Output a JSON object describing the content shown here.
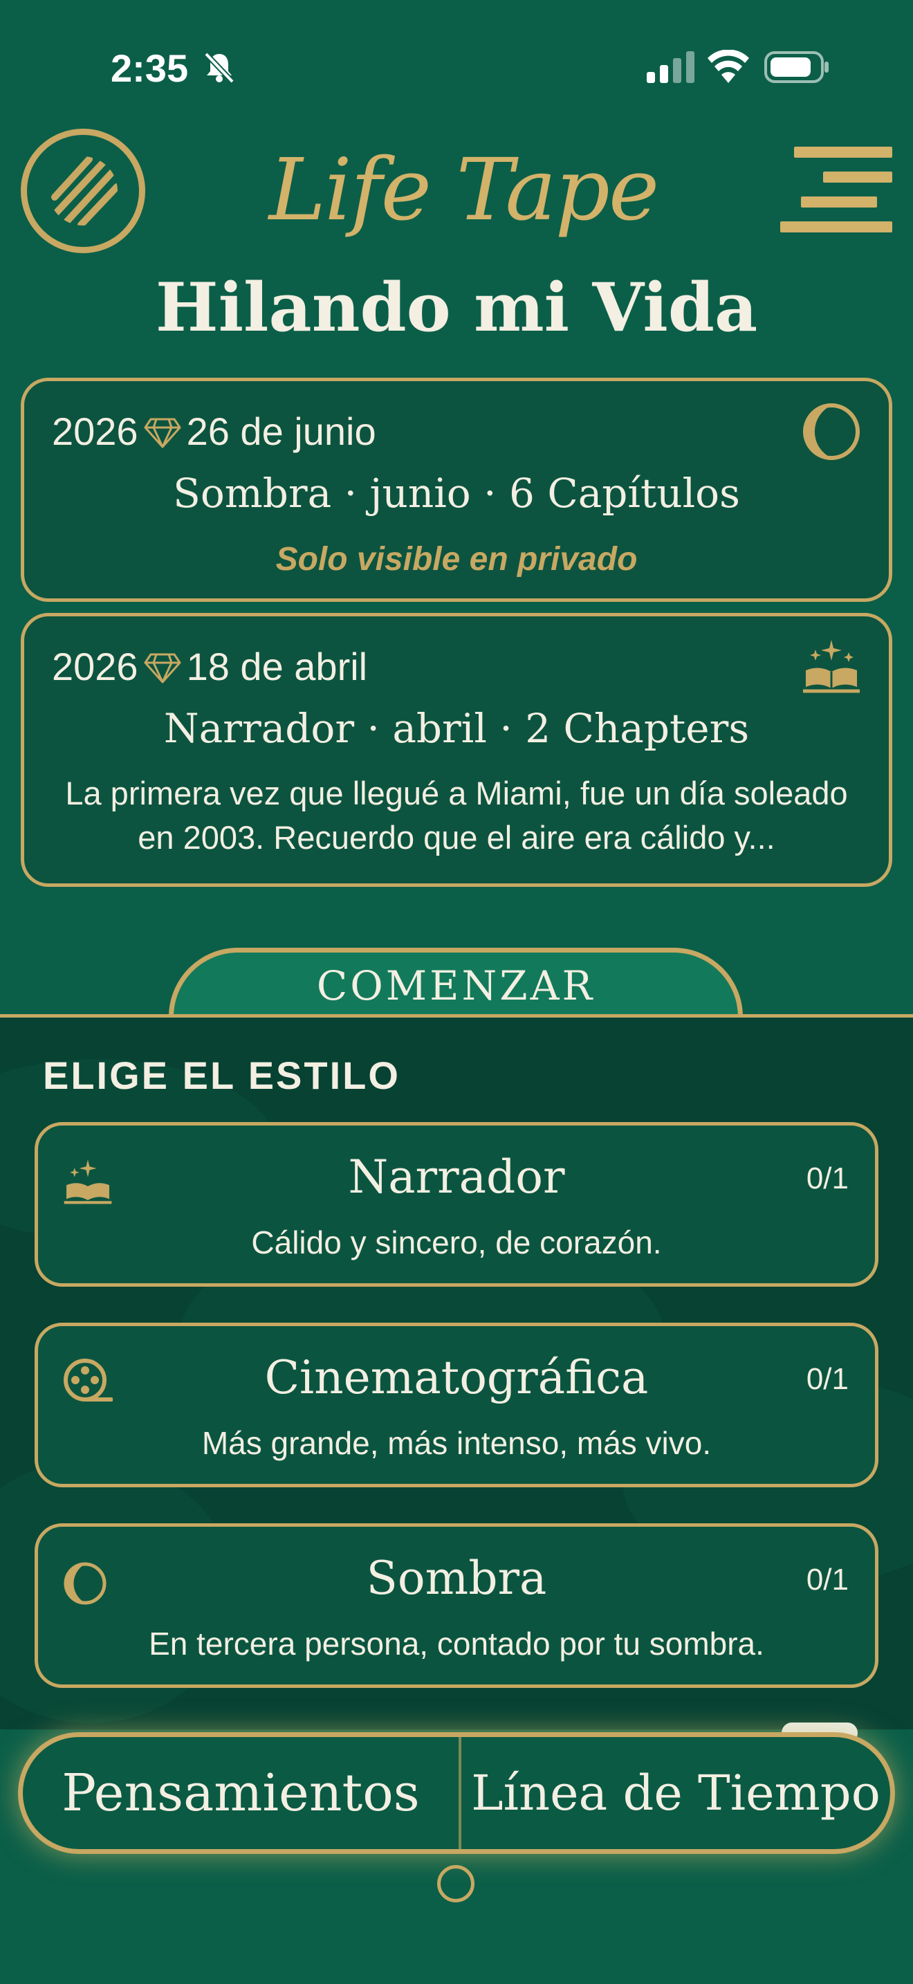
{
  "status_bar": {
    "time": "2:35",
    "silent_icon": "bell-slash-icon",
    "signal_icon": "signal-icon",
    "wifi_icon": "wifi-icon",
    "battery_icon": "battery-icon"
  },
  "header": {
    "brand": "Life Tape",
    "logo_icon": "striped-circle-logo-icon",
    "menu_icon": "menu-icon"
  },
  "page_title": "Hilando mi Vida",
  "tapes": [
    {
      "year": "2026",
      "date": "26 de junio",
      "meta": "Sombra · junio · 6 Capítulos",
      "note": "Solo visible en privado",
      "icon": "crescent-moon-icon"
    },
    {
      "year": "2026",
      "date": "18 de abril",
      "meta": "Narrador · abril · 2 Chapters",
      "excerpt": "La primera vez que llegué a Miami, fue un día soleado en 2003. Recuerdo que el aire era cálido y...",
      "icon": "sparkle-book-icon"
    }
  ],
  "start_button": "COMENZAR",
  "style_section": {
    "label": "ELIGE EL ESTILO",
    "styles": [
      {
        "name": "Narrador",
        "desc": "Cálido y sincero, de corazón.",
        "count": "0/1",
        "icon": "sparkle-book-icon"
      },
      {
        "name": "Cinematográfica",
        "desc": "Más grande, más intenso, más vivo.",
        "count": "0/1",
        "icon": "film-reel-icon"
      },
      {
        "name": "Sombra",
        "desc": "En tercera persona, contado por tu sombra.",
        "count": "0/1",
        "icon": "crescent-moon-icon"
      }
    ]
  },
  "bottom_tabs": {
    "left": "Pensamientos",
    "right": "Línea de Tiempo"
  },
  "colors": {
    "background": "#0b5f48",
    "gold": "#c8a862",
    "panel": "#074233",
    "text": "#f3efe2"
  }
}
